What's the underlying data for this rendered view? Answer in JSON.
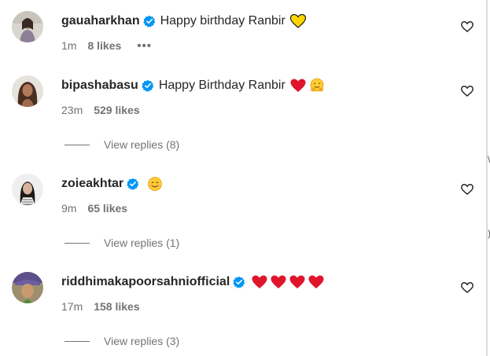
{
  "comments": [
    {
      "username": "gauaharkhan",
      "text": "Happy birthday Ranbir",
      "emojis": [
        "yellow-heart"
      ],
      "time": "1m",
      "likes": "8 likes",
      "more": "•••"
    },
    {
      "username": "bipashabasu",
      "text": "Happy Birthday Ranbir",
      "emojis": [
        "red-heart",
        "hugging-face"
      ],
      "time": "23m",
      "likes": "529 likes",
      "replies": "View replies (8)"
    },
    {
      "username": "zoieakhtar",
      "text": "",
      "emojis": [
        "smiling-face"
      ],
      "time": "9m",
      "likes": "65 likes",
      "replies": "View replies (1)"
    },
    {
      "username": "riddhimakapoorsahniofficial",
      "text": "",
      "emojis": [
        "red-heart",
        "red-heart",
        "red-heart",
        "red-heart"
      ],
      "time": "17m",
      "likes": "158 likes",
      "replies": "View replies (3)"
    }
  ],
  "colors": {
    "verified": "#0095f6",
    "red_heart": "#e0142b",
    "yellow_heart": "#ffd700",
    "secondary_text": "#737373"
  }
}
